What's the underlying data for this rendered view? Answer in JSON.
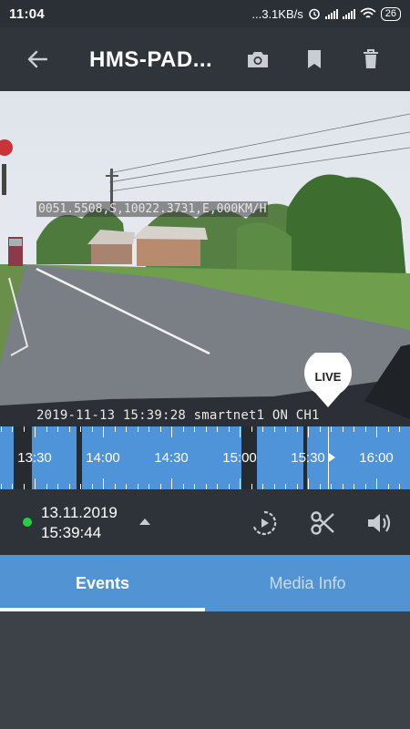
{
  "status_bar": {
    "time": "11:04",
    "net_speed": "...3.1KB/s",
    "battery": "26"
  },
  "toolbar": {
    "title": "HMS-PAD...",
    "icons": [
      "back-arrow-icon",
      "camera-icon",
      "bookmark-icon",
      "trash-icon"
    ]
  },
  "video": {
    "osd_top": "0051.5508,S,10022.3731,E,000KM/H",
    "osd_bottom": "2019-11-13 15:39:28 smartnet1 ON  CH1",
    "live_label": "LIVE"
  },
  "timeline": {
    "labels": [
      "13:30",
      "14:00",
      "14:30",
      "15:00",
      "15:30",
      "16:00"
    ],
    "color": "#4f93d8"
  },
  "controls": {
    "status_color": "#23d143",
    "date": "13.11.2019",
    "time": "15:39:44",
    "icons": [
      "expand-up-icon",
      "playback-speed-icon",
      "scissors-icon",
      "volume-icon"
    ]
  },
  "tabs": [
    {
      "label": "Events",
      "active": true
    },
    {
      "label": "Media Info",
      "active": false
    }
  ]
}
